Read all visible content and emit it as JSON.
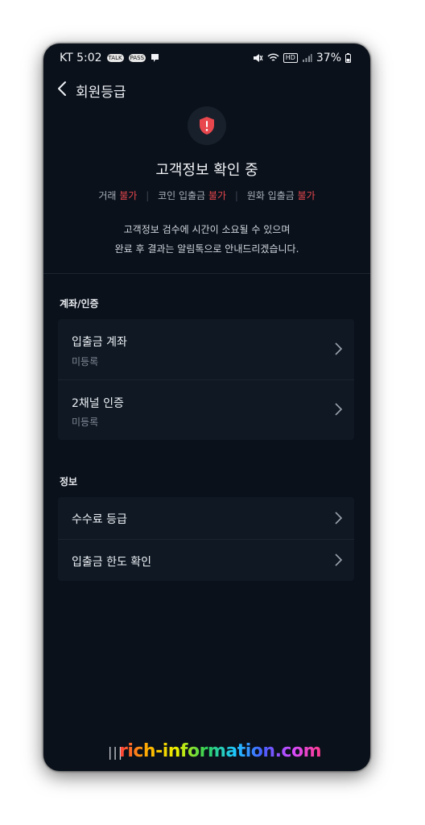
{
  "status_bar": {
    "carrier_time": "KT 5:02",
    "talk_badge": "TALK",
    "pass_badge": "PASS",
    "network": "HD",
    "battery": "37%"
  },
  "header": {
    "title": "회원등급"
  },
  "verification": {
    "title": "고객정보 확인 중",
    "limits": [
      {
        "label": "거래",
        "status": "불가"
      },
      {
        "label": "코인 입출금",
        "status": "불가"
      },
      {
        "label": "원화 입출금",
        "status": "불가"
      }
    ],
    "notice_line1": "고객정보 검수에 시간이 소요될 수 있으며",
    "notice_line2": "완료 후 결과는 알림톡으로 안내드리겠습니다."
  },
  "account_section": {
    "title": "계좌/인증",
    "items": [
      {
        "title": "입출금 계좌",
        "subtitle": "미등록"
      },
      {
        "title": "2채널 인증",
        "subtitle": "미등록"
      }
    ]
  },
  "info_section": {
    "title": "정보",
    "items": [
      {
        "title": "수수료 등급"
      },
      {
        "title": "입출금 한도 확인"
      }
    ]
  },
  "watermark": "rich-information.com",
  "colors": {
    "background": "#0a111b",
    "card": "#0f1823",
    "alert_red": "#e7474d"
  }
}
